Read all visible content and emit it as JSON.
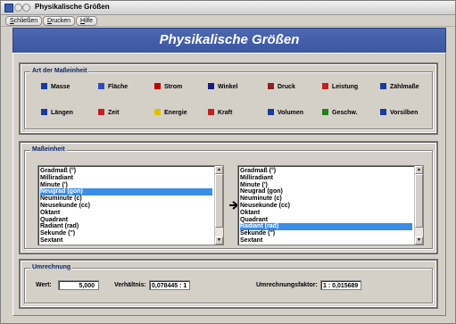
{
  "window": {
    "title": "Physikalische Größen"
  },
  "menu": [
    {
      "pre": "",
      "ul": "S",
      "post": "chließen"
    },
    {
      "pre": "",
      "ul": "D",
      "post": "rucken"
    },
    {
      "pre": "",
      "ul": "H",
      "post": "ilfe"
    }
  ],
  "header": {
    "title": "Physikalische Größen"
  },
  "unit_type": {
    "label": "Art der Maßeinheit",
    "row1": [
      {
        "label": "Masse",
        "icon": "mass-icon",
        "color": "#1a3aa0"
      },
      {
        "label": "Fläche",
        "icon": "area-icon",
        "color": "#2a4fc0"
      },
      {
        "label": "Strom",
        "icon": "current-icon",
        "color": "#c00000"
      },
      {
        "label": "Winkel",
        "icon": "angle-icon",
        "color": "#1a1a80"
      },
      {
        "label": "Druck",
        "icon": "pressure-icon",
        "color": "#902020"
      },
      {
        "label": "Leistung",
        "icon": "power-icon",
        "color": "#c02020"
      },
      {
        "label": "Zählmaße",
        "icon": "count-icon",
        "color": "#1a3aa0"
      }
    ],
    "row2": [
      {
        "label": "Längen",
        "icon": "length-icon",
        "color": "#1a3aa0"
      },
      {
        "label": "Zeit",
        "icon": "time-icon",
        "color": "#c02020"
      },
      {
        "label": "Energie",
        "icon": "energy-icon",
        "color": "#e0c000"
      },
      {
        "label": "Kraft",
        "icon": "force-icon",
        "color": "#c02020"
      },
      {
        "label": "Volumen",
        "icon": "volume-icon",
        "color": "#1a3aa0"
      },
      {
        "label": "Geschw.",
        "icon": "speed-icon",
        "color": "#208020"
      },
      {
        "label": "Vorsilben",
        "icon": "prefix-icon",
        "color": "#1a3aa0"
      }
    ]
  },
  "unit": {
    "label": "Maßeinheit",
    "left_list": [
      "Gradmaß (°)",
      "Milliradiant",
      "Minute (')",
      "Neugrad (gon)",
      "Neuminute (c)",
      "Neusekunde (cc)",
      "Oktant",
      "Quadrant",
      "Radiant (rad)",
      "Sekunde ('')",
      "Sextant"
    ],
    "left_selected": 3,
    "right_list": [
      "Gradmaß (°)",
      "Milliradiant",
      "Minute (')",
      "Neugrad (gon)",
      "Neuminute (c)",
      "Neusekunde (cc)",
      "Oktant",
      "Quadrant",
      "Radiant (rad)",
      "Sekunde ('')",
      "Sextant"
    ],
    "right_selected": 8,
    "arrow_icon": "arrow-right-icon"
  },
  "conversion": {
    "label": "Umrechnung",
    "value_label": "Wert:",
    "value": "5,000",
    "ratio_label": "Verhältnis:",
    "ratio": "0,078445 : 1",
    "factor_label": "Umrechnungsfaktor:",
    "factor": "1 : 0,015689"
  },
  "colors": {
    "header_bg": "#3f5aa6",
    "selection": "#3a8ee6",
    "group_title": "#0a246a"
  }
}
